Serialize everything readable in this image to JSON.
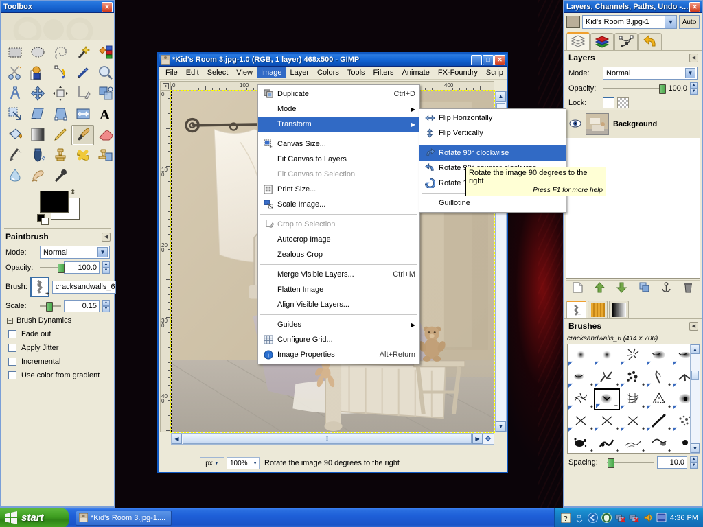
{
  "desktop": {
    "wallpaper_desc": "dark red abstract"
  },
  "toolbox": {
    "title": "Toolbox",
    "close_label": "✕",
    "tools": [
      {
        "name": "rect-select-tool",
        "icon": "rect-select"
      },
      {
        "name": "ellipse-select-tool",
        "icon": "ellipse-select"
      },
      {
        "name": "free-select-tool",
        "icon": "lasso"
      },
      {
        "name": "fuzzy-select-tool",
        "icon": "magic-wand"
      },
      {
        "name": "select-by-color-tool",
        "icon": "color-select"
      },
      {
        "name": "scissors-select-tool",
        "icon": "scissors"
      },
      {
        "name": "foreground-select-tool",
        "icon": "foreground-select"
      },
      {
        "name": "paths-tool",
        "icon": "paths"
      },
      {
        "name": "color-picker-tool",
        "icon": "eyedropper"
      },
      {
        "name": "zoom-tool",
        "icon": "magnifier"
      },
      {
        "name": "measure-tool",
        "icon": "compass"
      },
      {
        "name": "move-tool",
        "icon": "move-arrows"
      },
      {
        "name": "alignment-tool",
        "icon": "align"
      },
      {
        "name": "crop-tool",
        "icon": "crop"
      },
      {
        "name": "rotate-tool",
        "icon": "rotate"
      },
      {
        "name": "scale-tool",
        "icon": "scale"
      },
      {
        "name": "shear-tool",
        "icon": "shear"
      },
      {
        "name": "perspective-tool",
        "icon": "perspective"
      },
      {
        "name": "flip-tool",
        "icon": "flip"
      },
      {
        "name": "text-tool",
        "icon": "text-A"
      },
      {
        "name": "bucket-fill-tool",
        "icon": "bucket"
      },
      {
        "name": "blend-tool",
        "icon": "gradient"
      },
      {
        "name": "pencil-tool",
        "icon": "pencil"
      },
      {
        "name": "paintbrush-tool",
        "icon": "paintbrush",
        "selected": true
      },
      {
        "name": "eraser-tool",
        "icon": "eraser"
      },
      {
        "name": "airbrush-tool",
        "icon": "airbrush"
      },
      {
        "name": "ink-tool",
        "icon": "ink"
      },
      {
        "name": "clone-tool",
        "icon": "clone-stamp"
      },
      {
        "name": "heal-tool",
        "icon": "heal-bandaid"
      },
      {
        "name": "perspective-clone-tool",
        "icon": "perspective-clone"
      },
      {
        "name": "blur-sharpen-tool",
        "icon": "water-drop"
      },
      {
        "name": "smudge-tool",
        "icon": "smudge-finger"
      },
      {
        "name": "dodge-burn-tool",
        "icon": "dodge-burn"
      }
    ],
    "colors": {
      "foreground": "#000000",
      "background": "#ffffff"
    },
    "options": {
      "title": "Paintbrush",
      "mode_label": "Mode:",
      "mode_value": "Normal",
      "opacity_label": "Opacity:",
      "opacity_value": "100.0",
      "brush_label": "Brush:",
      "brush_value": "cracksandwalls_6",
      "scale_label": "Scale:",
      "scale_value": "0.15",
      "brush_dynamics_label": "Brush Dynamics",
      "checkboxes": [
        {
          "label": "Fade out",
          "checked": false
        },
        {
          "label": "Apply Jitter",
          "checked": false
        },
        {
          "label": "Incremental",
          "checked": false
        },
        {
          "label": "Use color from gradient",
          "checked": false
        }
      ]
    }
  },
  "image_window": {
    "title": "*Kid's Room 3.jpg-1.0 (RGB, 1 layer) 468x500 - GIMP",
    "buttons": {
      "minimize": "_",
      "maximize": "□",
      "close": "✕"
    },
    "menubar": [
      {
        "label": "File",
        "u": "F"
      },
      {
        "label": "Edit",
        "u": "E"
      },
      {
        "label": "Select",
        "u": "S"
      },
      {
        "label": "View",
        "u": "V"
      },
      {
        "label": "Image",
        "u": "I",
        "active": true
      },
      {
        "label": "Layer",
        "u": "L"
      },
      {
        "label": "Colors",
        "u": "C"
      },
      {
        "label": "Tools",
        "u": "T"
      },
      {
        "label": "Filters",
        "u": "r"
      },
      {
        "label": "Animate",
        "u": ""
      },
      {
        "label": "FX-Foundry",
        "u": ""
      },
      {
        "label": "Scrip",
        "u": ""
      }
    ],
    "rulers": {
      "horizontal": [
        "0",
        "100",
        "400"
      ],
      "vertical": [
        "0",
        "100",
        "200",
        "300",
        "400"
      ]
    },
    "statusbar": {
      "unit": "px",
      "zoom": "100%",
      "message": "Rotate the image 90 degrees to the right"
    }
  },
  "image_menu": {
    "items": [
      {
        "label": "Duplicate",
        "u": "D",
        "shortcut": "Ctrl+D",
        "icon": "duplicate-icon"
      },
      {
        "label": "Mode",
        "u": "M",
        "submenu": true
      },
      {
        "label": "Transform",
        "u": "T",
        "submenu": true,
        "highlighted": true
      },
      {
        "sep": true
      },
      {
        "label": "Canvas Size...",
        "u": "v",
        "icon": "canvas-size-icon"
      },
      {
        "label": "Fit Canvas to Layers",
        "u": "t"
      },
      {
        "label": "Fit Canvas to Selection",
        "u": "t",
        "disabled": true
      },
      {
        "label": "Print Size...",
        "u": "P",
        "icon": "print-size-icon"
      },
      {
        "label": "Scale Image...",
        "u": "S",
        "icon": "scale-image-icon"
      },
      {
        "sep": true
      },
      {
        "label": "Crop to Selection",
        "u": "C",
        "disabled": true,
        "icon": "crop-icon"
      },
      {
        "label": "Autocrop Image",
        "u": "A"
      },
      {
        "label": "Zealous Crop",
        "u": "Z"
      },
      {
        "sep": true
      },
      {
        "label": "Merge Visible Layers...",
        "u": "L",
        "shortcut": "Ctrl+M"
      },
      {
        "label": "Flatten Image",
        "u": "F"
      },
      {
        "label": "Align Visible Layers...",
        "u": "b"
      },
      {
        "sep": true
      },
      {
        "label": "Guides",
        "u": "G",
        "submenu": true
      },
      {
        "label": "Configure Grid...",
        "u": "r",
        "icon": "grid-icon"
      },
      {
        "label": "Image Properties",
        "u": "P",
        "shortcut": "Alt+Return",
        "icon": "info-icon"
      }
    ]
  },
  "transform_menu": {
    "items": [
      {
        "label": "Flip Horizontally",
        "u": "H",
        "icon": "flip-horizontal-icon"
      },
      {
        "label": "Flip Vertically",
        "u": "V",
        "icon": "flip-vertical-icon"
      },
      {
        "sep": true
      },
      {
        "label": "Rotate 90° clockwise",
        "u": "c",
        "icon": "rotate-cw-icon",
        "highlighted": true
      },
      {
        "label": "Rotate 90° counter-clockwise",
        "u": "9",
        "icon": "rotate-ccw-icon"
      },
      {
        "label": "Rotate 180°",
        "u": "1",
        "icon": "rotate-180-icon"
      },
      {
        "sep": true
      },
      {
        "label": "Guillotine",
        "u": "G"
      }
    ]
  },
  "tooltip": {
    "text": "Rotate the image 90 degrees to the right",
    "hint": "Press F1 for more help"
  },
  "dock": {
    "title": "Layers, Channels, Paths, Undo -...",
    "close_label": "✕",
    "image_name": "Kid's Room 3.jpg-1",
    "auto_label": "Auto",
    "tabs": [
      {
        "name": "layers-tab",
        "label": "Layers",
        "selected": true
      },
      {
        "name": "channels-tab",
        "label": "Channels"
      },
      {
        "name": "paths-tab",
        "label": "Paths"
      },
      {
        "name": "undo-history-tab",
        "label": "Undo History"
      }
    ],
    "layers": {
      "title": "Layers",
      "mode_label": "Mode:",
      "mode_value": "Normal",
      "opacity_label": "Opacity:",
      "opacity_value": "100.0",
      "lock_label": "Lock:",
      "rows": [
        {
          "name": "Background",
          "visible": true
        }
      ]
    },
    "layer_buttons": [
      {
        "name": "new-layer-button",
        "icon": "page-icon"
      },
      {
        "name": "raise-layer-button",
        "icon": "up-arrow-icon"
      },
      {
        "name": "lower-layer-button",
        "icon": "down-arrow-icon"
      },
      {
        "name": "duplicate-layer-button",
        "icon": "duplicate-icon"
      },
      {
        "name": "anchor-layer-button",
        "icon": "anchor-icon"
      },
      {
        "name": "delete-layer-button",
        "icon": "trash-icon"
      }
    ],
    "brush_tabs": [
      {
        "name": "brushes-tab",
        "selected": true
      },
      {
        "name": "patterns-tab"
      },
      {
        "name": "gradients-tab"
      }
    ],
    "brushes": {
      "title": "Brushes",
      "current": "cracksandwalls_6 (414 x 706)",
      "spacing_label": "Spacing:",
      "spacing_value": "10.0",
      "selected_index": 11
    }
  },
  "taskbar": {
    "start_label": "start",
    "items": [
      {
        "label": "*Kid's Room 3.jpg-1...."
      }
    ],
    "clock": "4:36 PM"
  }
}
